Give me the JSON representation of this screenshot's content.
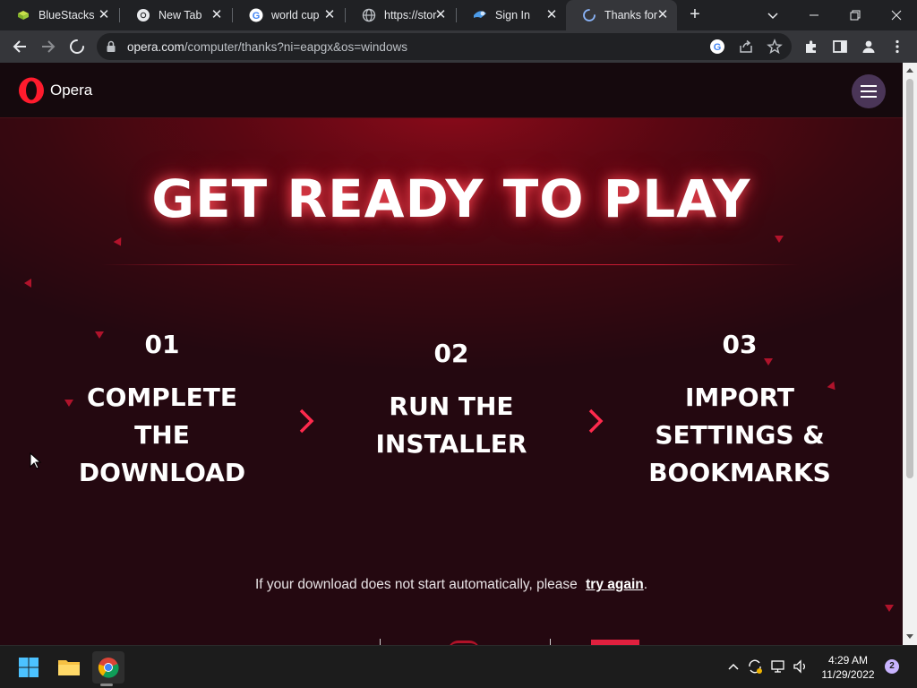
{
  "browser": {
    "tabs": [
      {
        "title": "BlueStacks",
        "icon": "bluestacks-icon"
      },
      {
        "title": "New Tab",
        "icon": "chrome-icon"
      },
      {
        "title": "world cup",
        "icon": "google-icon"
      },
      {
        "title": "https://stor",
        "icon": "globe-icon"
      },
      {
        "title": "Sign In",
        "icon": "steam-icon"
      },
      {
        "title": "Thanks for",
        "icon": "loading-icon",
        "active": true
      }
    ],
    "new_tab_label": "+",
    "url_host": "opera.com",
    "url_path": "/computer/thanks?ni=eapgx&os=windows"
  },
  "page": {
    "brand": "Opera",
    "headline": "GET READY TO PLAY",
    "steps": [
      {
        "number": "01",
        "label_lines": [
          "COMPLETE",
          "THE",
          "DOWNLOAD"
        ]
      },
      {
        "number": "02",
        "label_lines": [
          "RUN THE",
          "INSTALLER"
        ]
      },
      {
        "number": "03",
        "label_lines": [
          "IMPORT",
          "SETTINGS &",
          "BOOKMARKS"
        ]
      }
    ],
    "footnote_text": "If your download does not start automatically, please",
    "footnote_link": "try again",
    "footnote_end": "."
  },
  "taskbar": {
    "apps": [
      "windows-start-icon",
      "file-explorer-icon",
      "chrome-icon"
    ],
    "time": "4:29 AM",
    "date": "11/29/2022",
    "notification_count": "2"
  },
  "colors": {
    "accent_red": "#e0203e",
    "chrome_dark": "#202124",
    "chrome_toolbar": "#35363a"
  }
}
